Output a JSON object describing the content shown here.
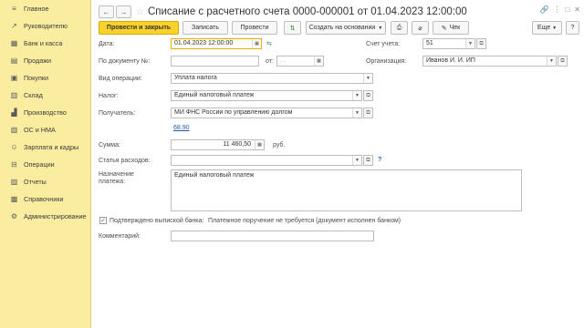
{
  "sidebar": {
    "items": [
      {
        "label": "Главное",
        "icon": "menu-icon"
      },
      {
        "label": "Руководителю",
        "icon": "trend-icon"
      },
      {
        "label": "Банк и касса",
        "icon": "bank-icon"
      },
      {
        "label": "Продажи",
        "icon": "cart-icon"
      },
      {
        "label": "Покупки",
        "icon": "basket-icon"
      },
      {
        "label": "Склад",
        "icon": "warehouse-icon"
      },
      {
        "label": "Производство",
        "icon": "factory-icon"
      },
      {
        "label": "ОС и НМА",
        "icon": "assets-icon"
      },
      {
        "label": "Зарплата и кадры",
        "icon": "people-icon"
      },
      {
        "label": "Операции",
        "icon": "operations-icon"
      },
      {
        "label": "Отчеты",
        "icon": "reports-icon"
      },
      {
        "label": "Справочники",
        "icon": "reference-icon"
      },
      {
        "label": "Администрирование",
        "icon": "gear-icon"
      }
    ]
  },
  "header": {
    "title": "Списание с расчетного счета 0000-000001 от 01.04.2023 12:00:00",
    "back_glyph": "←",
    "forward_glyph": "→"
  },
  "toolbar": {
    "post_close": "Провести и закрыть",
    "save": "Записать",
    "post": "Провести",
    "create_basis": "Создать на основании",
    "check": "Чек",
    "more": "Еще"
  },
  "form": {
    "date_label": "Дата:",
    "date_value": "01.04.2023 12:00:00",
    "account_label": "Счет учета:",
    "account_value": "51",
    "doc_no_label": "По документу №:",
    "doc_no_value": "",
    "from_label": "от:",
    "from_value": ". .",
    "org_label": "Организация:",
    "org_value": "Иванов И. И. ИП",
    "op_type_label": "Вид операции:",
    "op_type_value": "Уплата налога",
    "tax_label": "Налог:",
    "tax_value": "Единый налоговый платеж",
    "recipient_label": "Получатель:",
    "recipient_value": "МИ ФНС России по управлению долгом",
    "recipient_link": "68.90",
    "sum_label": "Сумма:",
    "sum_value": "11 460,50",
    "currency": "руб.",
    "expense_label": "Статья расходов:",
    "expense_value": "",
    "purpose_label_1": "Назначение",
    "purpose_label_2": "платежа:",
    "purpose_value": "Единый налоговый платеж",
    "confirmed_label": "Подтверждено выпиской банка:",
    "confirmed_note": "Платежное поручение не требуется (документ исполнен банком)",
    "comment_label": "Комментарий:",
    "comment_value": "",
    "help_glyph": "?"
  }
}
